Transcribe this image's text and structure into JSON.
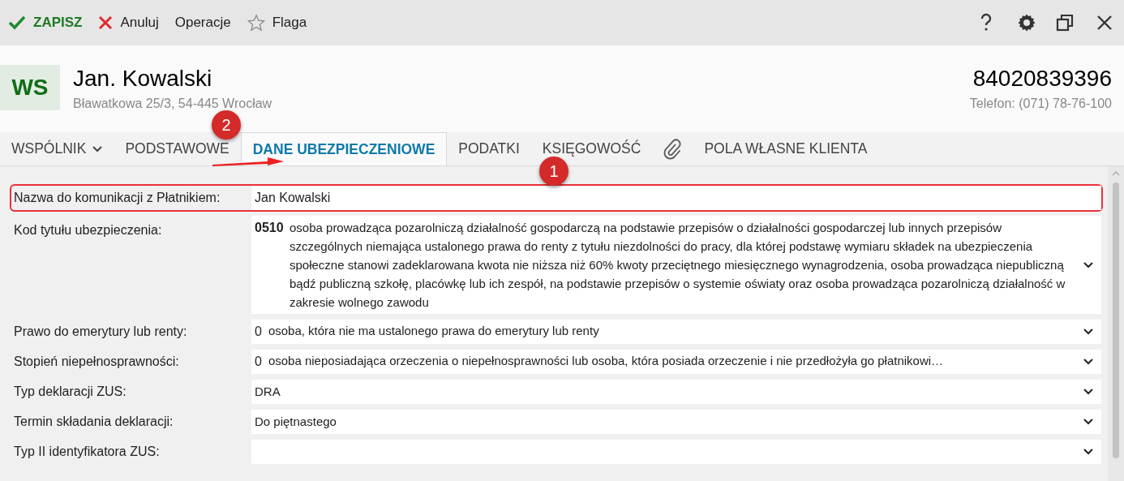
{
  "toolbar": {
    "actions": [
      {
        "kind": "save",
        "label": "ZAPISZ"
      },
      {
        "kind": "cancel",
        "label": "Anuluj"
      },
      {
        "kind": "plain",
        "label": "Operacje"
      },
      {
        "kind": "flag",
        "label": "Flaga"
      }
    ]
  },
  "header": {
    "avatar": "WS",
    "name": "Jan. Kowalski",
    "address": "Bławatkowa 25/3, 54-445 Wrocław",
    "id_number": "84020839396",
    "phone": "Telefon: (071) 78-76-100"
  },
  "tabs": [
    {
      "kind": "dropdown",
      "label": "WSPÓLNIK",
      "selected": false
    },
    {
      "kind": "text",
      "label": "PODSTAWOWE",
      "selected": false
    },
    {
      "kind": "text",
      "label": "DANE UBEZPIECZENIOWE",
      "selected": true
    },
    {
      "kind": "text",
      "label": "PODATKI",
      "selected": false
    },
    {
      "kind": "text",
      "label": "KSIĘGOWOŚĆ",
      "selected": false
    },
    {
      "kind": "attachment",
      "selected": false
    },
    {
      "kind": "text",
      "label": "POLA WŁASNE KLIENTA",
      "selected": false
    }
  ],
  "fields": [
    {
      "kind": "text",
      "label": "Nazwa do komunikacji z Płatnikiem:",
      "value": "Jan Kowalski",
      "highlighted": true
    },
    {
      "kind": "select",
      "label": "Kod tytułu ubezpieczenia:",
      "code": "0510",
      "value": "osoba prowadząca pozarolniczą działalność gospodarczą na podstawie przepisów o działalności gospodarczej lub innych przepisów szczególnych niemająca ustalonego prawa do renty z tytułu niezdolności do pracy, dla której podstawę wymiaru składek na ubezpieczenia społeczne stanowi zadeklarowana kwota nie niższa niż 60% kwoty przeciętnego miesięcznego wynagrodzenia, osoba prowadząca niepubliczną bądź publiczną szkołę, placówkę lub ich zespół, na podstawie przepisów o systemie oświaty oraz osoba prowadząca pozarolniczą działalność w zakresie wolnego zawodu",
      "highlighted": false
    },
    {
      "kind": "select",
      "label": "Prawo do emerytury lub renty:",
      "code": "0",
      "value": "osoba, która nie ma ustalonego prawa do emerytury lub renty",
      "highlighted": false
    },
    {
      "kind": "select",
      "label": "Stopień niepełnosprawności:",
      "code": "0",
      "value": "osoba nieposiadająca orzeczenia o niepełnosprawności lub osoba, która posiada orzeczenie i nie przedłożyła go płatnikowi…",
      "highlighted": false
    },
    {
      "kind": "select",
      "label": "Typ deklaracji ZUS:",
      "value": "DRA",
      "highlighted": false
    },
    {
      "kind": "select",
      "label": "Termin składania deklaracji:",
      "value": "Do piętnastego",
      "highlighted": false
    },
    {
      "kind": "select",
      "label": "Typ II identyfikatora ZUS:",
      "highlighted": false
    }
  ],
  "annotations": [
    {
      "kind": "badge",
      "label": "2"
    },
    {
      "kind": "arrow"
    },
    {
      "kind": "badge",
      "label": "1"
    }
  ]
}
